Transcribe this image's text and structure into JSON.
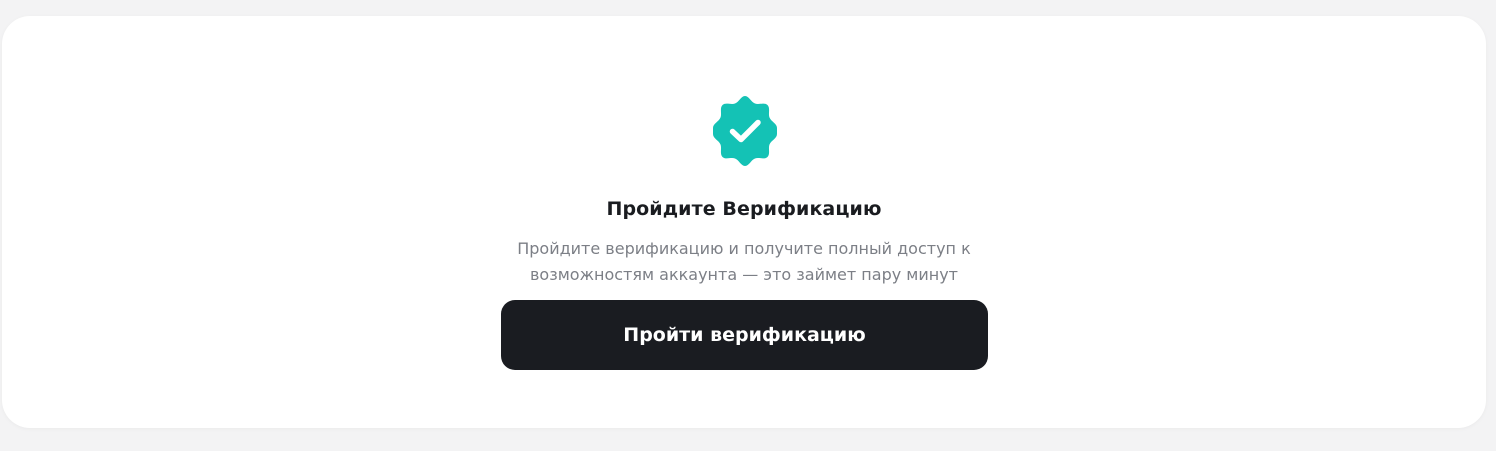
{
  "verification": {
    "icon": "verified-badge-icon",
    "accent_color": "#14c2b5",
    "title": "Пройдите Верификацию",
    "description": "Пройдите верификацию и получите полный доступ к возможностям аккаунта — это займет пару минут",
    "button_label": "Пройти верификацию",
    "button_color": "#1a1c21"
  }
}
